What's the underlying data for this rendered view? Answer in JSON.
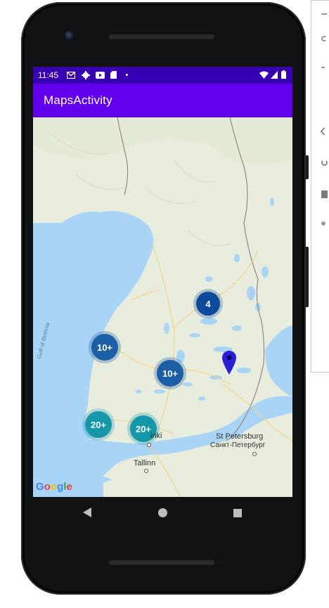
{
  "status_bar": {
    "time": "11:45",
    "left_icons": [
      "gmail-icon",
      "settings-icon",
      "youtube-icon",
      "sd-card-icon",
      "dot-icon"
    ],
    "right_icons": [
      "wifi-icon",
      "signal-icon",
      "battery-icon"
    ]
  },
  "app_bar": {
    "title": "MapsActivity"
  },
  "map": {
    "clusters": [
      {
        "label": "4",
        "style": "dark"
      },
      {
        "label": "10+",
        "style": "blue"
      },
      {
        "label": "10+",
        "style": "blue"
      },
      {
        "label": "20+",
        "style": "teal"
      },
      {
        "label": "20+",
        "style": "teal"
      }
    ],
    "labels": {
      "st_petersburg": "St Petersburg",
      "st_petersburg_cyrillic": "Санкт-Петербург",
      "tallinn": "Tallinn",
      "helsinki_partial": "inki",
      "gulf_of_bothnia": "Gulf of Bothnia"
    },
    "marker": "map-pin-icon",
    "marker_color": "#2a1fd6",
    "attribution": "Google"
  },
  "navigation": {
    "back": "back-icon",
    "home": "home-icon",
    "recents": "recents-icon"
  },
  "colors": {
    "status_bar": "#3700b3",
    "app_bar": "#6200ee",
    "water": "#a9d4f5",
    "land": "#e8ecdd"
  }
}
